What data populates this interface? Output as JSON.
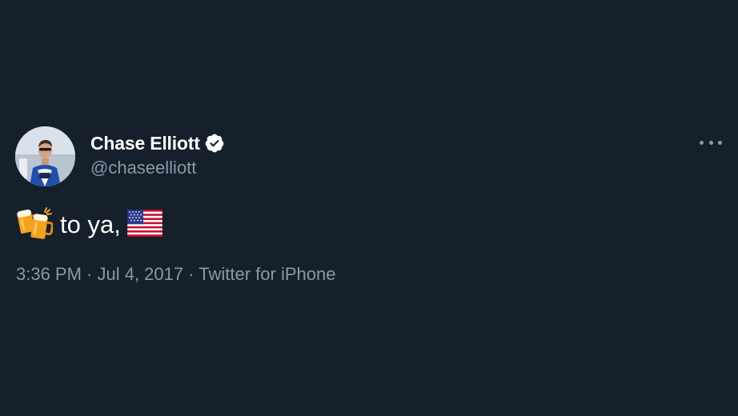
{
  "tweet": {
    "display_name": "Chase Elliott",
    "verified": true,
    "handle": "@chaseelliott",
    "body_text": "to ya,",
    "body_emojis": [
      "beer-mugs-emoji",
      "us-flag-emoji"
    ],
    "metadata": "3:36 PM · Jul 4, 2017 · Twitter for iPhone"
  },
  "colors": {
    "background": "#15202b",
    "primary_text": "#ffffff",
    "secondary_text": "#8899a6"
  },
  "icons": {
    "verified": "verified-badge-icon",
    "more": "more-options-icon"
  }
}
